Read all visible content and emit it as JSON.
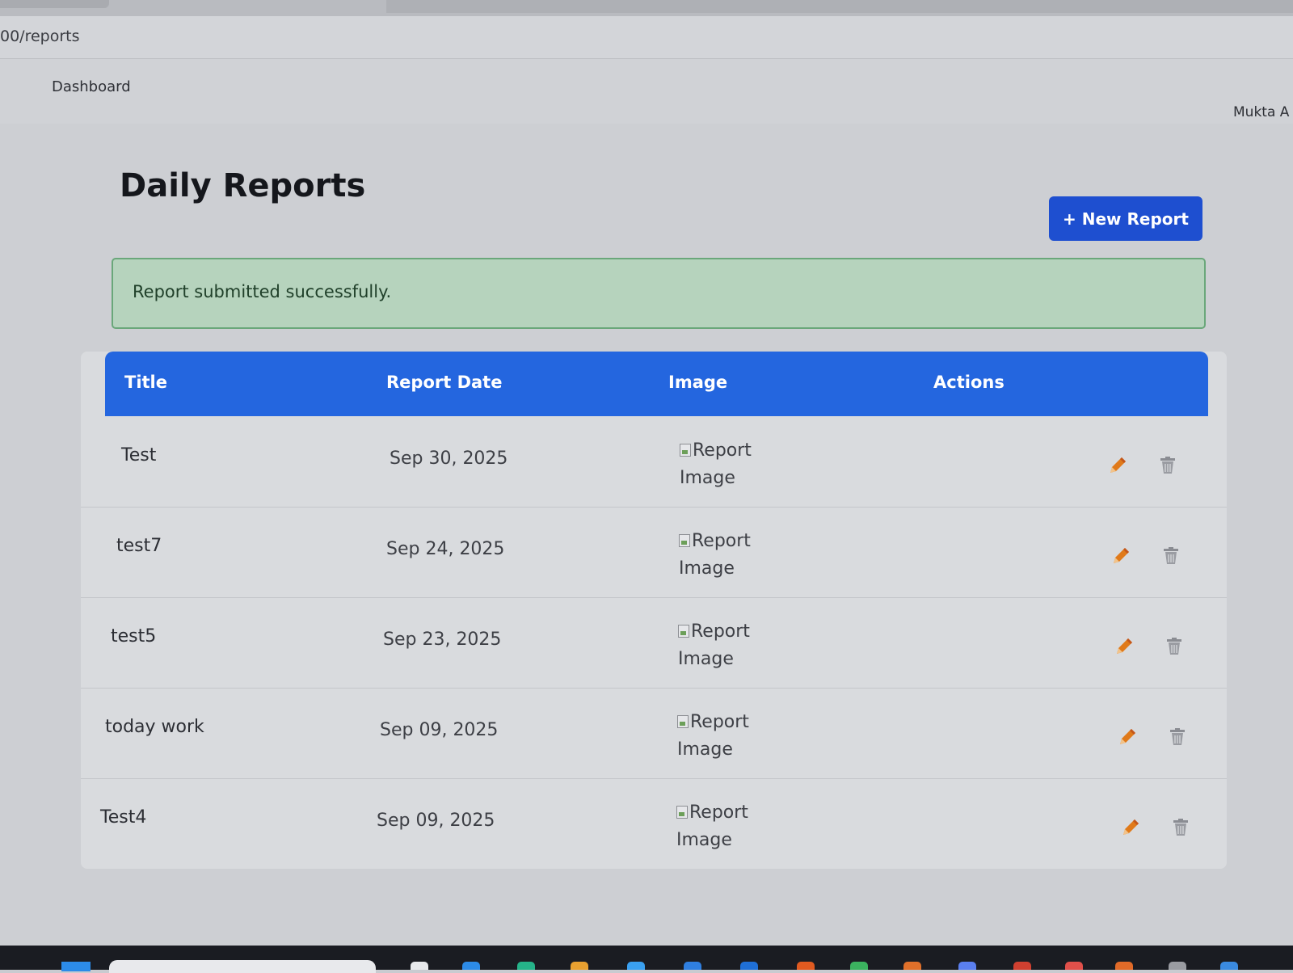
{
  "browser": {
    "url": "00/reports"
  },
  "nav": {
    "dashboard_label": "Dashboard",
    "user_name": "Mukta A"
  },
  "page": {
    "title": "Daily Reports",
    "new_report_label": "+ New Report"
  },
  "alert": {
    "message": "Report submitted successfully."
  },
  "table": {
    "headers": {
      "title": "Title",
      "date": "Report Date",
      "image": "Image",
      "actions": "Actions"
    },
    "rows": [
      {
        "title": "Test",
        "date": "Sep 30, 2025",
        "image_alt": "Report Image"
      },
      {
        "title": "test7",
        "date": "Sep 24, 2025",
        "image_alt": "Report Image"
      },
      {
        "title": "test5",
        "date": "Sep 23, 2025",
        "image_alt": "Report Image"
      },
      {
        "title": "today work",
        "date": "Sep 09, 2025",
        "image_alt": "Report Image"
      },
      {
        "title": "Test4",
        "date": "Sep 09, 2025",
        "image_alt": "Report Image"
      }
    ]
  },
  "icons": {
    "edit": "pencil-icon",
    "delete": "trash-icon",
    "broken_image": "broken-image-icon"
  },
  "colors": {
    "primary": "#2466df",
    "button": "#1e4fd0",
    "alert_bg": "#b6d3bd",
    "alert_border": "#6aa77a",
    "edit_icon": "#e07a1a",
    "delete_icon": "#8a8c92"
  }
}
